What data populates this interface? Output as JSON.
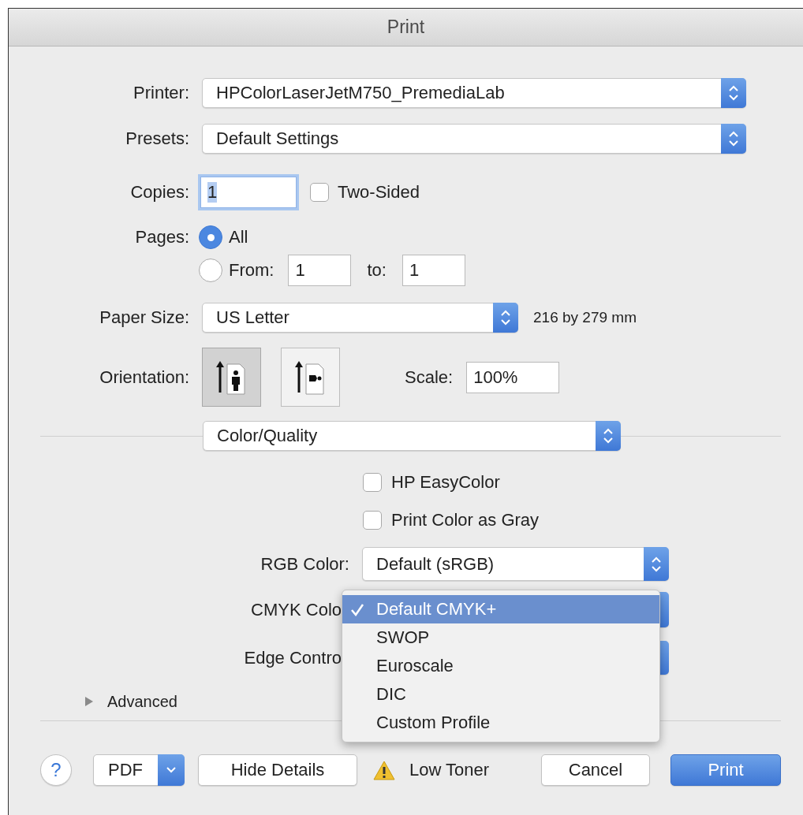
{
  "window": {
    "title": "Print"
  },
  "printer": {
    "label": "Printer:",
    "value": "HPColorLaserJetM750_PremediaLab"
  },
  "presets": {
    "label": "Presets:",
    "value": "Default Settings"
  },
  "copies": {
    "label": "Copies:",
    "value": "1",
    "focused": true
  },
  "two_sided": {
    "label": "Two-Sided",
    "checked": false
  },
  "pages": {
    "label": "Pages:",
    "options": [
      {
        "kind": "all",
        "label": "All",
        "selected": true
      },
      {
        "kind": "range",
        "label": "From:",
        "selected": false,
        "from": "1",
        "to_label": "to:",
        "to": "1"
      }
    ]
  },
  "paper_size": {
    "label": "Paper Size:",
    "value": "US Letter",
    "dimensions": "216 by 279 mm"
  },
  "orientation": {
    "label": "Orientation:",
    "options": [
      {
        "kind": "portrait",
        "selected": true
      },
      {
        "kind": "landscape",
        "selected": false
      }
    ]
  },
  "scale": {
    "label": "Scale:",
    "value": "100%"
  },
  "section_popup": {
    "value": "Color/Quality"
  },
  "options": [
    {
      "kind": "checkbox",
      "label": "HP EasyColor",
      "checked": false
    },
    {
      "kind": "checkbox",
      "label": "Print Color as Gray",
      "checked": false
    },
    {
      "kind": "popup",
      "label": "RGB Color:",
      "value": "Default (sRGB)"
    },
    {
      "kind": "popup",
      "label": "CMYK Colo"
    },
    {
      "kind": "popup",
      "label": "Edge Contro"
    }
  ],
  "open_menu": {
    "items": [
      {
        "label": "Default CMYK+",
        "selected": true
      },
      {
        "label": "SWOP",
        "selected": false
      },
      {
        "label": "Euroscale",
        "selected": false
      },
      {
        "label": "DIC",
        "selected": false
      },
      {
        "label": "Custom Profile",
        "selected": false
      }
    ]
  },
  "advanced": {
    "label": "Advanced",
    "expanded": false
  },
  "buttons": [
    {
      "kind": "help",
      "label": "?"
    },
    {
      "kind": "menu",
      "label": "PDF"
    },
    {
      "kind": "push",
      "label": "Hide Details"
    },
    {
      "kind": "status",
      "label": "Low Toner"
    },
    {
      "kind": "push",
      "label": "Cancel"
    },
    {
      "kind": "default",
      "label": "Print"
    }
  ]
}
